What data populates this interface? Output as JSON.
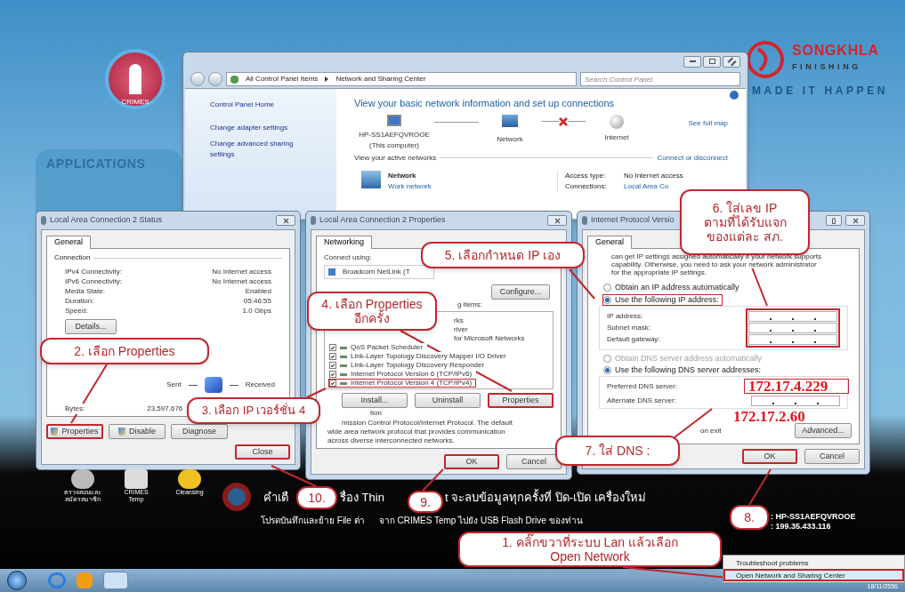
{
  "desktop": {
    "top_shortcut": "CRIMES",
    "apps_heading": "APPLICATIONS",
    "logo": {
      "name": "SONGKHLA",
      "sub": "FINISHING",
      "slogan": "MADE IT HAPPEN"
    },
    "bottom_shortcuts": [
      {
        "label": "ตรวจสอบและ\nสมัครสมาชิก"
      },
      {
        "label": "CRIMES\nTemp"
      },
      {
        "label": "Cleansing"
      }
    ],
    "warning_line_1": [
      "คำเตื",
      "รื่อง Thin",
      "t จะลบข้อมูลทุกครั้งที่ ปิด-เปิด เครื่องใหม่"
    ],
    "warning_line_2": [
      "โปรดบันทึกและย้าย File ต่า",
      "จาก CRIMES Temp ไปยัง USB Flash Drive ของท่าน"
    ],
    "info_lines": [
      ": HP-SS1AEFQVROOE",
      ": 199.35.433.116"
    ]
  },
  "network_center": {
    "breadcrumb": [
      "All Control Panel Items",
      "Network and Sharing Center"
    ],
    "search_placeholder": "Search Control Panel",
    "left_links": [
      "Control Panel Home",
      "Change adapter settings",
      "Change advanced sharing settings"
    ],
    "heading": "View your basic network information and set up connections",
    "computer": "HP-SS1AEFQVROOE",
    "computer_note": "(This computer)",
    "network": "Network",
    "internet": "Internet",
    "see_full_map": "See full map",
    "active_heading": "View your active networks",
    "connect_link": "Connect or disconnect",
    "active_network": {
      "name": "Network",
      "type": "Work network"
    },
    "details": [
      {
        "label": "Access type:",
        "value": "No Internet access",
        "link": false
      },
      {
        "label": "Connections:",
        "value": "Local Area Co",
        "link": true
      }
    ]
  },
  "status_dialog": {
    "title": "Local Area Connection 2 Status",
    "tab": "General",
    "section": "Connection",
    "rows": [
      {
        "label": "IPv4 Connectivity:",
        "value": "No Internet access"
      },
      {
        "label": "IPv6 Connectivity:",
        "value": "No Internet access"
      },
      {
        "label": "Media State:",
        "value": "Enabled"
      },
      {
        "label": "Duration:",
        "value": "05:46:55"
      },
      {
        "label": "Speed:",
        "value": "1.0 Gbps"
      }
    ],
    "details_button": "Details...",
    "sent": "Sent",
    "received": "Received",
    "bytes_label": "Bytes:",
    "bytes_sent": "23,597,676",
    "buttons": [
      {
        "label": "Properties",
        "shield": true,
        "highlighted": true
      },
      {
        "label": "Disable",
        "shield": true,
        "highlighted": false
      },
      {
        "label": "Diagnose",
        "shield": false,
        "highlighted": false
      }
    ],
    "close": {
      "label": "Close",
      "highlighted": true
    }
  },
  "properties_dialog": {
    "title": "Local Area Connection 2 Properties",
    "tab": "Networking",
    "connect_using": "Connect using:",
    "adapter": "Broadcom NetLink (T",
    "configure": "Configure...",
    "items_label": "g items:",
    "items": [
      {
        "label": "rks",
        "covered": true,
        "highlighted": false
      },
      {
        "label": "river",
        "covered": true,
        "highlighted": false
      },
      {
        "label": "for Microsoft Networks",
        "covered": true,
        "highlighted": false
      },
      {
        "label": "QoS Packet Scheduler",
        "checked": true,
        "covered": false,
        "highlighted": false
      },
      {
        "label": "Link-Layer Topology Discovery Mapper I/O Driver",
        "checked": true,
        "covered": false,
        "highlighted": false
      },
      {
        "label": "Link-Layer Topology Discovery Responder",
        "checked": true,
        "covered": false,
        "highlighted": false
      },
      {
        "label": "Internet Protocol Version 6 (TCP/IPv6)",
        "checked": true,
        "covered": false,
        "highlighted": false
      },
      {
        "label": "Internet Protocol Version 4 (TCP/IPv4)",
        "checked": true,
        "covered": false,
        "highlighted": true
      }
    ],
    "buttons": [
      {
        "label": "Install...",
        "highlighted": false
      },
      {
        "label": "Uninstall",
        "highlighted": false
      },
      {
        "label": "Properties",
        "highlighted": true
      }
    ],
    "description_label": "tion",
    "description": [
      "mission Control Protocol/Internet Protocol. The default",
      "wide area network protocol that provides communication",
      "across diverse interconnected networks."
    ],
    "footer": [
      {
        "label": "OK",
        "highlighted": true
      },
      {
        "label": "Cancel",
        "highlighted": false
      }
    ]
  },
  "ipv4_dialog": {
    "title": "Internet Protocol Versio",
    "tab": "General",
    "intro": [
      "can get IP settings assigned automatically if your network supports",
      "capability. Otherwise, you need to ask your network administrator",
      "for the appropriate IP settings."
    ],
    "ip_radios": [
      {
        "label": "Obtain an IP address automatically",
        "selected": false,
        "disabled": false,
        "highlighted": false
      },
      {
        "label": "Use the following IP address:",
        "selected": true,
        "disabled": false,
        "highlighted": true
      }
    ],
    "ip_fields": [
      "IP address:",
      "Subnet mask:",
      "Default gateway:"
    ],
    "ip_fields_highlighted": true,
    "dns_radios": [
      {
        "label": "Obtain DNS server address automatically",
        "selected": false,
        "disabled": true,
        "highlighted": false
      },
      {
        "label": "Use the following DNS server addresses:",
        "selected": true,
        "disabled": false,
        "highlighted": false
      }
    ],
    "dns_fields": [
      {
        "label": "Preferred DNS server:",
        "annotation": "172.17.4.229",
        "highlighted": true
      },
      {
        "label": "Alternate DNS server:",
        "annotation": "172.17.2.60",
        "highlighted": false
      }
    ],
    "validate": "on exit",
    "advanced": "Advanced...",
    "footer": [
      {
        "label": "OK",
        "highlighted": true
      },
      {
        "label": "Cancel",
        "highlighted": false
      }
    ]
  },
  "tray_menu": [
    {
      "label": "Troubleshoot problems",
      "selected": false
    },
    {
      "label": "Open Network and Sharing Center",
      "selected": true
    }
  ],
  "clock": "18/11/2556",
  "callouts": [
    "1. คลิ๊กขวาที่ระบบ Lan แล้วเลือก\nOpen Network",
    "2. เลือก Properties",
    "3. เลือก IP เวอร์ชั่น 4",
    "4. เลือก Properties\nอีกครั้ง",
    "5. เลือกกำหนด IP เอง",
    "6. ใส่เลข IP\nตามที่ได้รับแจก\nของแต่ละ สภ.",
    "7. ใส่ DNS :",
    "8.",
    "9.",
    "10."
  ]
}
